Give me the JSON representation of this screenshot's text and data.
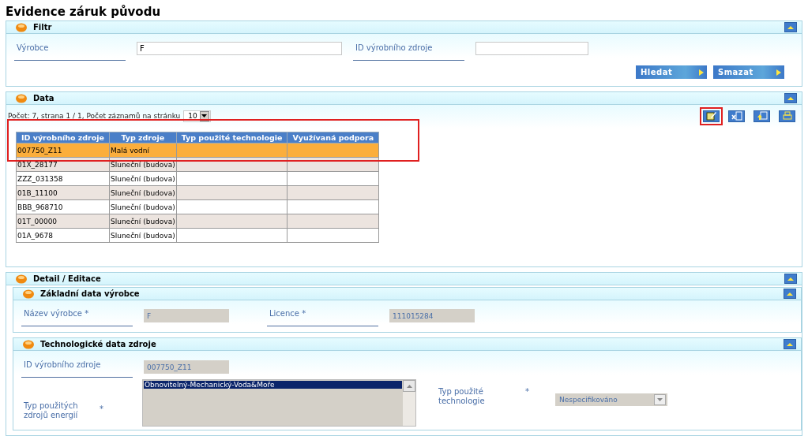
{
  "title": "Evidence záruk původu",
  "filter": {
    "title": "Filtr",
    "expanded": true,
    "fields": [
      {
        "label": "Výrobce",
        "value": "F"
      },
      {
        "label": "ID výrobního zdroje"
      }
    ],
    "buttons": [
      "Hledat",
      "Smazat"
    ]
  },
  "data": {
    "title": "Data",
    "expanded": true,
    "paging": "Počet: 7, strana 1 / 1, Počet záznamů na stránku",
    "page_size": "10",
    "toolbar": [
      {
        "kind": "edit",
        "highlighted": true
      },
      {
        "kind": "delete",
        "highlighted": false
      },
      {
        "kind": "export",
        "highlighted": false
      },
      {
        "kind": "print",
        "highlighted": false
      }
    ],
    "table": {
      "highlighted": true,
      "columns": [
        "ID výrobního zdroje",
        "Typ zdroje",
        "Typ použité technologie",
        "Využívaná podpora"
      ],
      "rows": [
        {
          "cells": [
            "007750_Z11",
            "Malá vodní",
            "",
            ""
          ],
          "selected": true
        },
        {
          "cells": [
            "01X_28177",
            "Sluneční (budova)",
            "",
            ""
          ],
          "selected": false
        },
        {
          "cells": [
            "ZZZ_031358",
            "Sluneční (budova)",
            "",
            ""
          ],
          "selected": false
        },
        {
          "cells": [
            "01B_11100",
            "Sluneční (budova)",
            "",
            ""
          ],
          "selected": false
        },
        {
          "cells": [
            "BBB_968710",
            "Sluneční (budova)",
            "",
            ""
          ],
          "selected": false
        },
        {
          "cells": [
            "01T_00000",
            "Sluneční (budova)",
            "",
            ""
          ],
          "selected": false
        },
        {
          "cells": [
            "01A_9678",
            "Sluneční (budova)",
            "",
            ""
          ],
          "selected": false
        }
      ]
    }
  },
  "detail": {
    "title": "Detail / Editace",
    "expanded": true,
    "sections": [
      {
        "title": "Základní data výrobce",
        "expanded": true,
        "fields": [
          {
            "kind": "readonly",
            "label": "Název výrobce *",
            "value": "F"
          },
          {
            "kind": "readonly",
            "label": "Licence *",
            "value": "111015284"
          }
        ]
      },
      {
        "title": "Technologické data zdroje",
        "expanded": true,
        "fields": [
          {
            "kind": "readonly",
            "label": "ID výrobního zdroje",
            "value": "007750_Z11"
          },
          {
            "kind": "listbox",
            "label": "Typ použitých zdrojů energií",
            "required_mark": "*",
            "items": [
              {
                "label": "Obnovitelný-Mechanický-Voda&Moře",
                "selected": true
              }
            ]
          },
          {
            "kind": "select",
            "label": "Typ použité technologie",
            "required_mark": "*",
            "value": "Nespecifikováno"
          }
        ]
      }
    ]
  }
}
